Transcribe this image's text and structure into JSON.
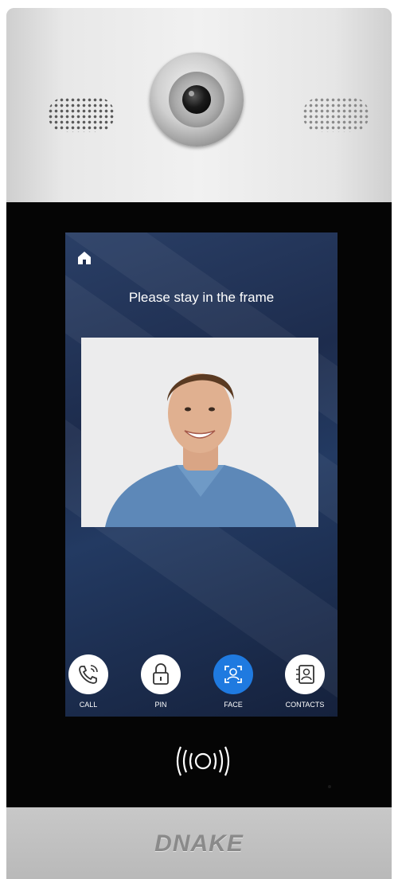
{
  "screen": {
    "prompt": "Please stay in the frame",
    "home_icon": "home-icon"
  },
  "dock": {
    "items": [
      {
        "label": "CALL",
        "icon": "phone-icon",
        "active": false
      },
      {
        "label": "PIN",
        "icon": "lock-icon",
        "active": false
      },
      {
        "label": "FACE",
        "icon": "face-scan-icon",
        "active": true
      },
      {
        "label": "CONTACTS",
        "icon": "contacts-icon",
        "active": false
      }
    ]
  },
  "device": {
    "brand": "DNAKE",
    "nfc_icon": "nfc-reader-icon"
  },
  "colors": {
    "active_button": "#1f7ae0",
    "inactive_button": "#ffffff",
    "screen_background": "#1d2c4d"
  }
}
